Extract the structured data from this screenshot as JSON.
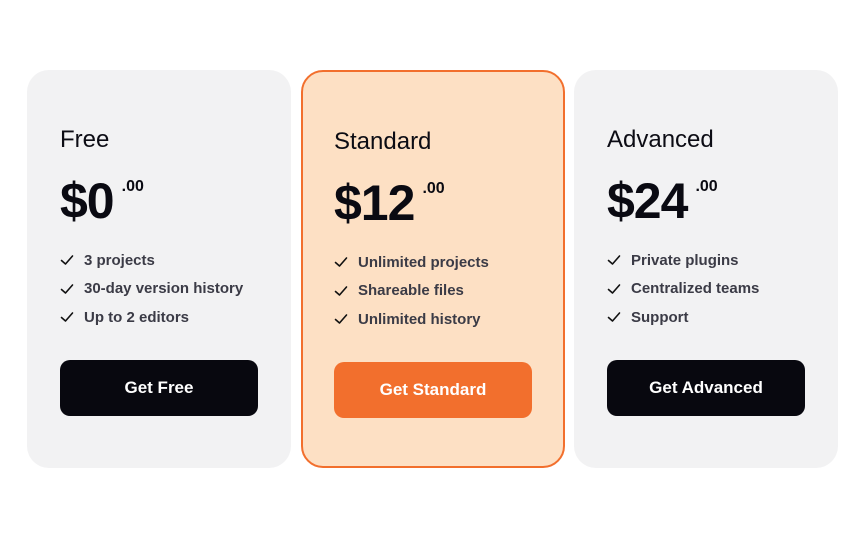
{
  "colors": {
    "accent": "#f26f2d",
    "highlight_bg": "#fde0c4",
    "card_bg": "#f2f2f3",
    "button_dark": "#08080f"
  },
  "plans": [
    {
      "name": "Free",
      "price": "$0",
      "cents": ".00",
      "features": [
        "3 projects",
        "30-day version history",
        "Up to 2 editors"
      ],
      "button": "Get Free",
      "highlighted": false
    },
    {
      "name": "Standard",
      "price": "$12",
      "cents": ".00",
      "features": [
        "Unlimited projects",
        "Shareable files",
        "Unlimited history"
      ],
      "button": "Get Standard",
      "highlighted": true
    },
    {
      "name": "Advanced",
      "price": "$24",
      "cents": ".00",
      "features": [
        "Private plugins",
        "Centralized teams",
        "Support"
      ],
      "button": "Get Advanced",
      "highlighted": false
    }
  ],
  "feature_icon": "check-icon"
}
